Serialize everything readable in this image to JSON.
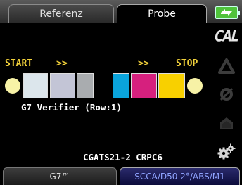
{
  "tabs": [
    {
      "label": "Referenz"
    },
    {
      "label": "Probe"
    }
  ],
  "toolbar": {
    "cal_label": "CAL"
  },
  "measurement": {
    "start_label": "START",
    "stop_label": "STOP",
    "arrow_left": ">>",
    "arrow_right": ">>",
    "patches": [
      {
        "color": "#dce6ec"
      },
      {
        "color": "#c3c5d6"
      },
      {
        "color": "#a9acaf"
      },
      {
        "color": "#0aa4dc"
      },
      {
        "color": "#d6207e"
      },
      {
        "color": "#f8d000"
      }
    ],
    "status": "G7 Verifier (Row:1)",
    "chart_name": "CGATS21-2 CRPC6"
  },
  "bottom_tabs": [
    {
      "label": "G7™"
    },
    {
      "label": "SCCA/D50 2°/ABS/M1"
    }
  ],
  "colors": {
    "accent_label": "#f3d23b",
    "battery": "#4fc33b",
    "condition_text": "#8fa3ff"
  }
}
